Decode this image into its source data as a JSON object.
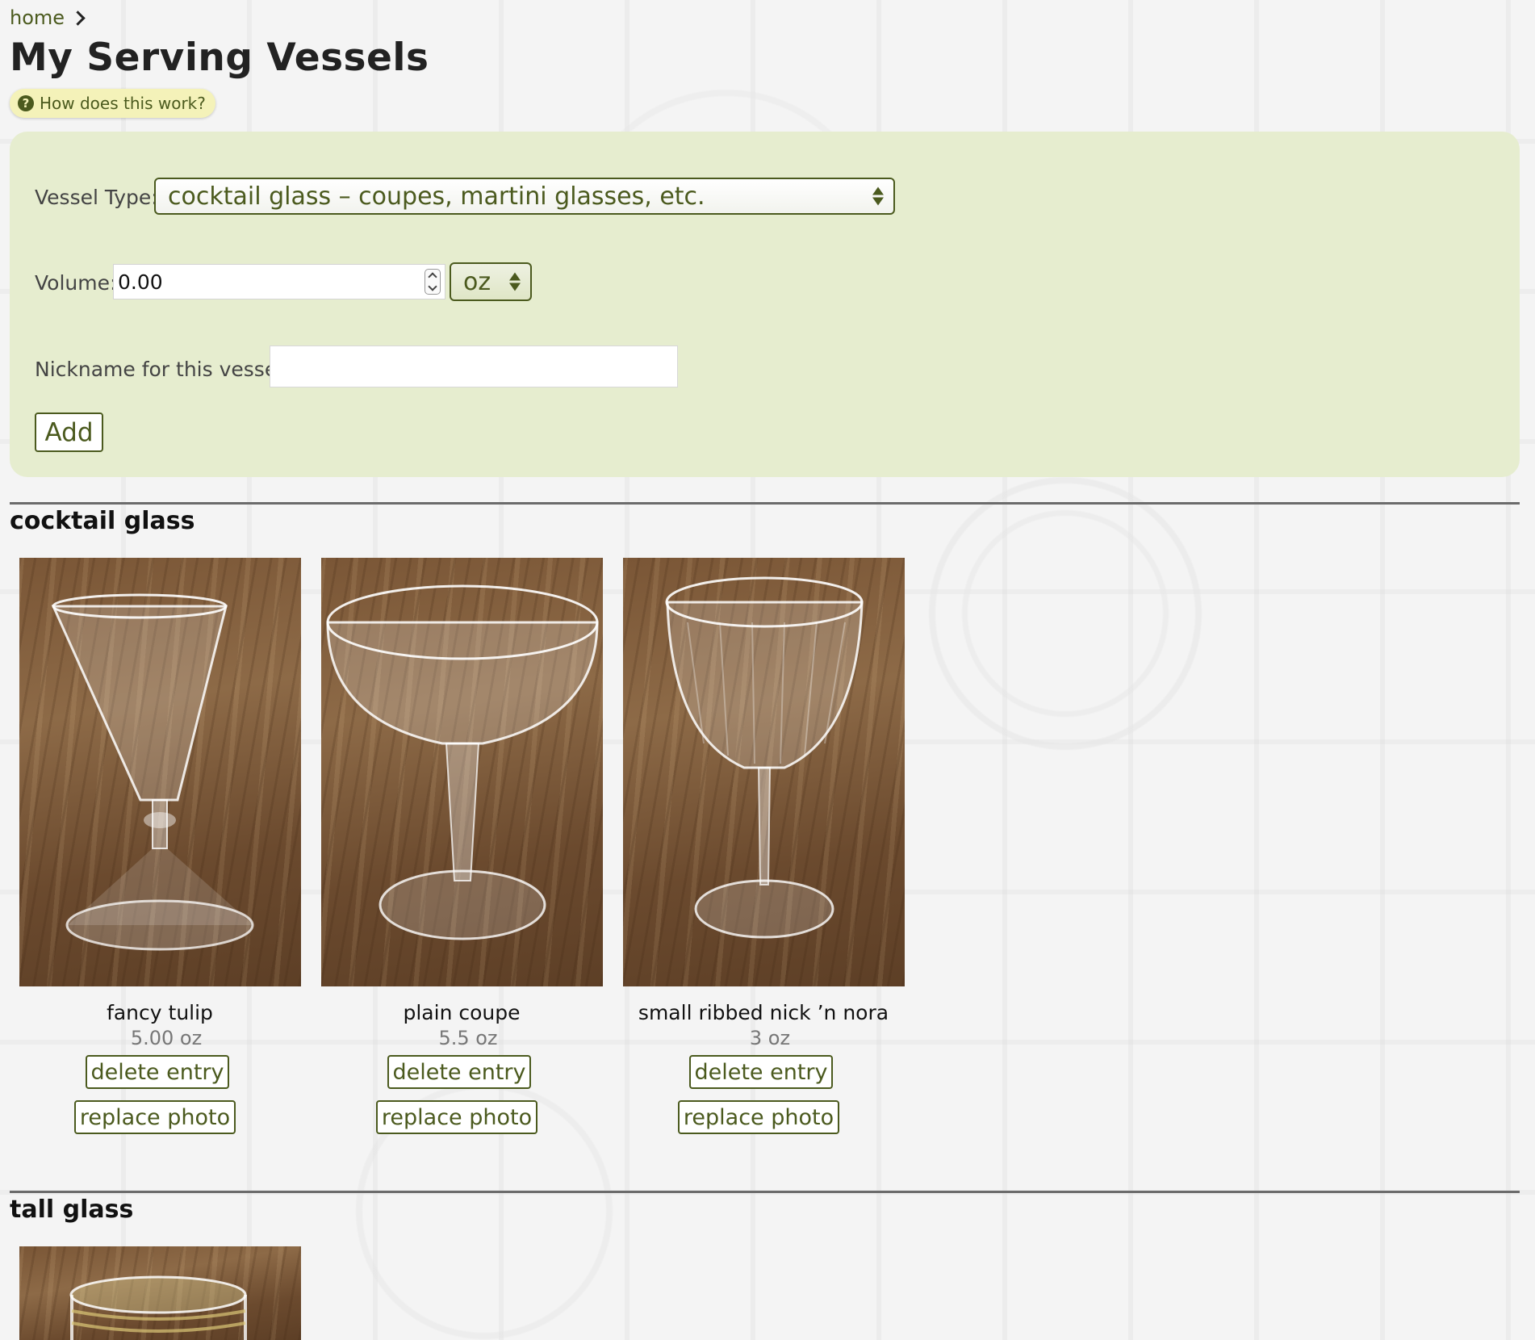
{
  "breadcrumb": {
    "home_label": "home"
  },
  "page": {
    "title": "My Serving Vessels",
    "help_label": "How does this work?"
  },
  "form": {
    "vessel_type_label": "Vessel Type:",
    "vessel_type_value": "cocktail glass – coupes, martini glasses, etc.",
    "volume_label": "Volume:",
    "volume_value": "0.00",
    "unit_value": "oz",
    "nickname_label": "Nickname for this vessel:",
    "nickname_value": "",
    "add_label": "Add"
  },
  "sections": [
    {
      "title": "cocktail glass",
      "vessels": [
        {
          "name": "fancy tulip",
          "volume": "5.00 oz",
          "delete_label": "delete entry",
          "replace_label": "replace photo"
        },
        {
          "name": "plain coupe",
          "volume": "5.5 oz",
          "delete_label": "delete entry",
          "replace_label": "replace photo"
        },
        {
          "name": "small ribbed nick ’n nora",
          "volume": "3 oz",
          "delete_label": "delete entry",
          "replace_label": "replace photo"
        }
      ]
    },
    {
      "title": "tall glass",
      "vessels": []
    }
  ],
  "colors": {
    "accent": "#4b5a1e",
    "panel": "#e6edcf",
    "help_pill": "#f4f2b9"
  }
}
